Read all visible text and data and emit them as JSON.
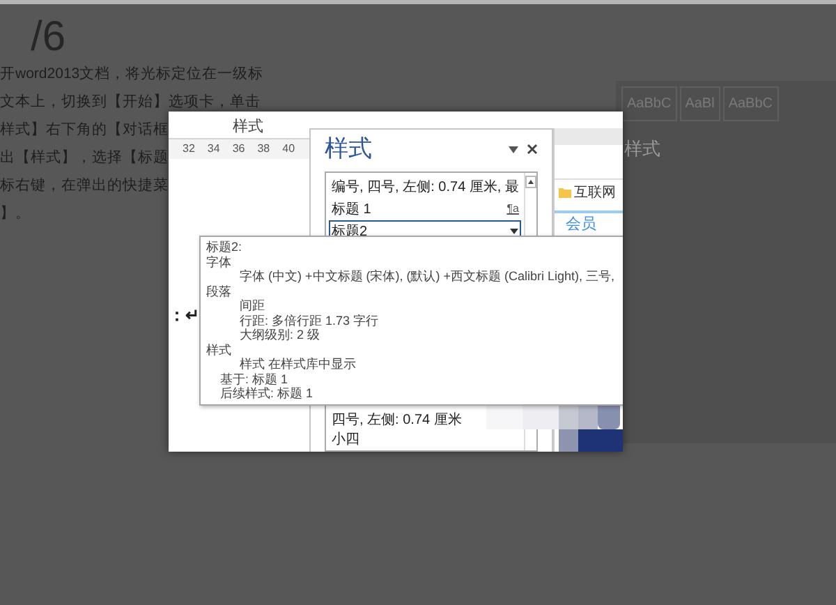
{
  "article": {
    "step": "/6",
    "lines": [
      "开word2013文档，将光标定位在一级标",
      "文本上，切换到【开始】选项卡，单击",
      "样式】右下角的【对话框",
      "出【样式】，选择【标题",
      "标右键，在弹出的快捷菜",
      "】。"
    ]
  },
  "background_window": {
    "gallery": [
      "AaBbC",
      "AaBl",
      "AaBbC"
    ],
    "pane_title": "样式"
  },
  "lightbox": {
    "ribbon_group": "样式",
    "ruler": [
      "32",
      "34",
      "36",
      "38",
      "40"
    ],
    "doc_text": "：↵",
    "styles_pane": {
      "title": "样式",
      "items": [
        {
          "label": "编号, 四号, 左侧:  0.74 厘米, 最",
          "selected": false
        },
        {
          "label": "标题 1",
          "selected": false,
          "mark": "¶a"
        },
        {
          "label": "标题2",
          "selected": true
        }
      ],
      "lower_items": [
        "四号, 左侧:  0.74 厘米",
        "小四"
      ]
    },
    "browser": {
      "bookmark": "互联网",
      "link": "会员"
    },
    "tooltip": {
      "lines": [
        {
          "kind": "heading",
          "text": "标题2:"
        },
        {
          "kind": "heading",
          "text": "字体"
        },
        {
          "kind": "detail",
          "text": "字体 (中文) +中文标题 (宋体), (默认) +西文标题 (Calibri Light), 三号,"
        },
        {
          "kind": "heading",
          "text": "段落"
        },
        {
          "kind": "detail",
          "text": "间距"
        },
        {
          "kind": "detail",
          "text": "行距: 多倍行距 1.73 字行"
        },
        {
          "kind": "detail",
          "text": "大纲级别:  2 级"
        },
        {
          "kind": "heading",
          "text": "样式"
        },
        {
          "kind": "detail",
          "text": "样式 在样式库中显示"
        },
        {
          "kind": "note",
          "text": "基于: 标题 1"
        },
        {
          "kind": "note",
          "text": "后续样式: 标题 1"
        }
      ]
    }
  }
}
